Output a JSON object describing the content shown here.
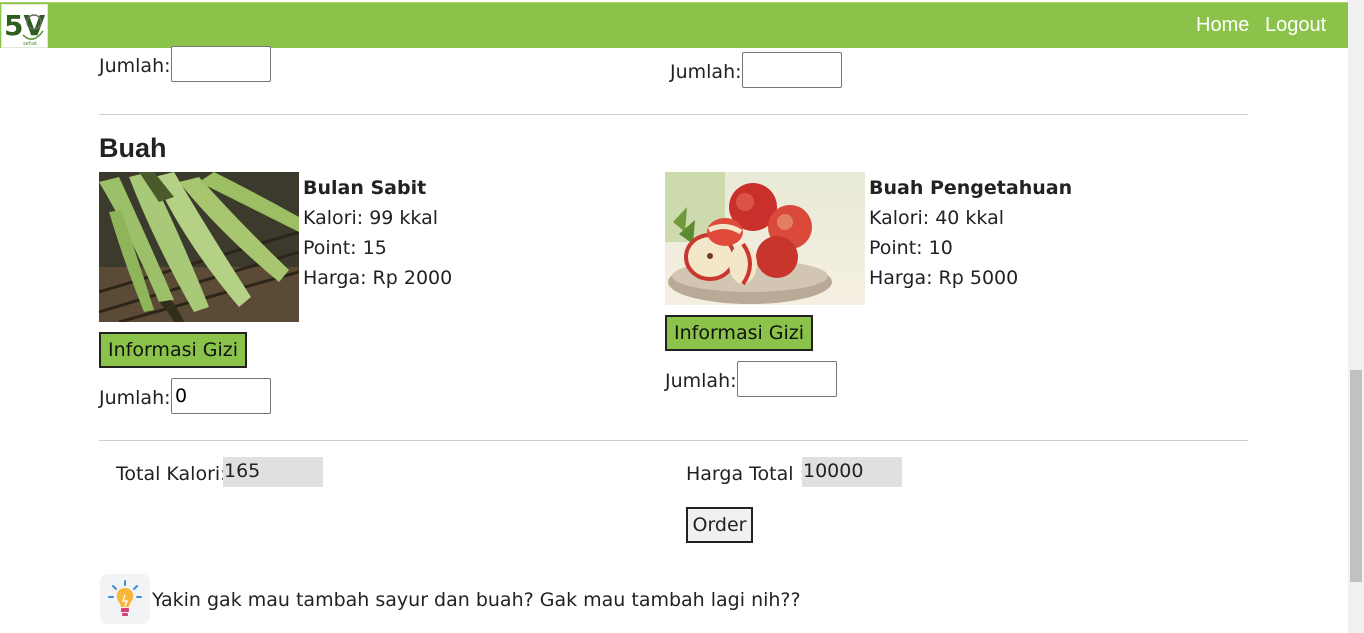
{
  "nav": {
    "logo_text": "5V",
    "logo_subtext": "sehat",
    "home": "Home",
    "logout": "Logout"
  },
  "top_row": {
    "left_qty_label": "Jumlah:",
    "left_qty_value": "",
    "right_qty_label": "Jumlah:",
    "right_qty_value": ""
  },
  "section": {
    "title": "Buah"
  },
  "products": [
    {
      "name": "Bulan Sabit",
      "kalori": "Kalori: 99 kkal",
      "point": "Point: 15",
      "harga": "Harga: Rp 2000",
      "button": "Informasi Gizi",
      "qty_label": "Jumlah:",
      "qty_value": "0",
      "image_icon": "banana-image"
    },
    {
      "name": "Buah Pengetahuan",
      "kalori": "Kalori: 40 kkal",
      "point": "Point: 10",
      "harga": "Harga: Rp 5000",
      "button": "Informasi Gizi",
      "qty_label": "Jumlah:",
      "qty_value": "",
      "image_icon": "apple-image"
    }
  ],
  "summary": {
    "total_kalori_label": "Total Kalori:",
    "total_kalori_value": "165",
    "harga_total_label": "Harga Total :",
    "harga_total_value": "10000",
    "order_button": "Order"
  },
  "tip": {
    "icon": "lightbulb-icon",
    "text": "Yakin gak mau tambah sayur dan buah? Gak mau tambah lagi nih??"
  },
  "colors": {
    "accent": "#8bc34a",
    "readonly_bg": "#e0e0e0"
  }
}
